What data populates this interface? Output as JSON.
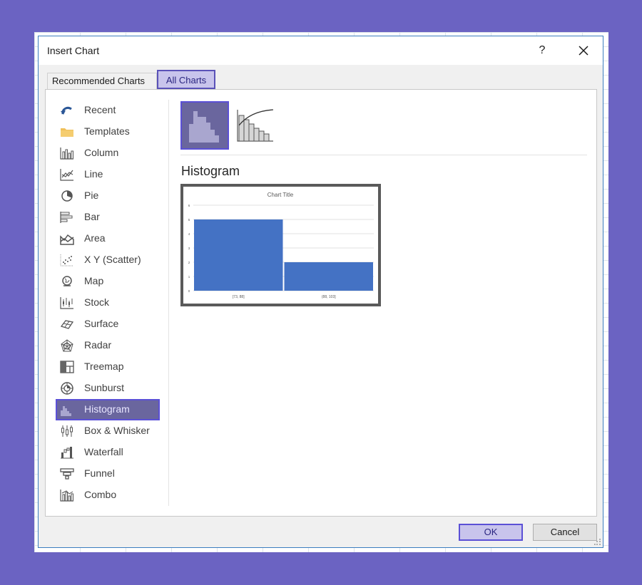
{
  "dialog": {
    "title": "Insert Chart",
    "help": "?"
  },
  "tabs": [
    {
      "label": "Recommended Charts",
      "active": false
    },
    {
      "label": "All Charts",
      "active": true
    }
  ],
  "chart_types": [
    {
      "label": "Recent",
      "icon": "recent-icon"
    },
    {
      "label": "Templates",
      "icon": "folder-icon"
    },
    {
      "label": "Column",
      "icon": "column-chart-icon"
    },
    {
      "label": "Line",
      "icon": "line-chart-icon"
    },
    {
      "label": "Pie",
      "icon": "pie-chart-icon"
    },
    {
      "label": "Bar",
      "icon": "bar-chart-icon"
    },
    {
      "label": "Area",
      "icon": "area-chart-icon"
    },
    {
      "label": "X Y (Scatter)",
      "icon": "scatter-chart-icon"
    },
    {
      "label": "Map",
      "icon": "globe-icon"
    },
    {
      "label": "Stock",
      "icon": "stock-chart-icon"
    },
    {
      "label": "Surface",
      "icon": "surface-chart-icon"
    },
    {
      "label": "Radar",
      "icon": "radar-chart-icon"
    },
    {
      "label": "Treemap",
      "icon": "treemap-icon"
    },
    {
      "label": "Sunburst",
      "icon": "sunburst-icon"
    },
    {
      "label": "Histogram",
      "icon": "histogram-icon",
      "selected": true
    },
    {
      "label": "Box & Whisker",
      "icon": "box-whisker-icon"
    },
    {
      "label": "Waterfall",
      "icon": "waterfall-icon"
    },
    {
      "label": "Funnel",
      "icon": "funnel-icon"
    },
    {
      "label": "Combo",
      "icon": "combo-chart-icon"
    }
  ],
  "subtypes": [
    {
      "icon": "histogram-subtype-icon",
      "selected": true
    },
    {
      "icon": "pareto-subtype-icon",
      "selected": false
    }
  ],
  "selected_chart_name": "Histogram",
  "preview": {
    "chart_data": {
      "type": "bar",
      "title": "Chart Title",
      "categories": [
        "[73, 88]",
        "(88, 103]"
      ],
      "values": [
        5,
        2
      ],
      "ylim": [
        0,
        6
      ],
      "y_ticks": [
        "0",
        "1",
        "2",
        "3",
        "4",
        "5",
        "6"
      ],
      "grid": true,
      "bar_color": "#4472c4"
    }
  },
  "buttons": {
    "ok": "OK",
    "cancel": "Cancel"
  },
  "colors": {
    "accent": "#5b50d6",
    "selection_fill": "#6a669e",
    "background": "#6b63c2"
  }
}
